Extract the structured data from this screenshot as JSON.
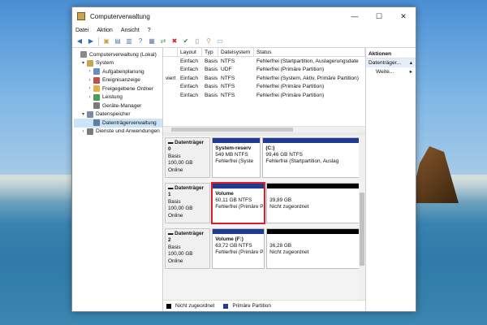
{
  "window": {
    "title": "Computerverwaltung"
  },
  "menu": [
    "Datei",
    "Aktion",
    "Ansicht",
    "?"
  ],
  "tree": [
    {
      "label": "Computerverwaltung (Lokal)",
      "level": 0,
      "exp": "",
      "color": "#8a8a8a"
    },
    {
      "label": "System",
      "level": 1,
      "exp": "▾",
      "color": "#c9a54b"
    },
    {
      "label": "Aufgabenplanung",
      "level": 2,
      "exp": "›",
      "color": "#6a8fbf"
    },
    {
      "label": "Ereignisanzeige",
      "level": 2,
      "exp": "›",
      "color": "#c0504d"
    },
    {
      "label": "Freigegebene Ordner",
      "level": 2,
      "exp": "›",
      "color": "#e3b341"
    },
    {
      "label": "Leistung",
      "level": 2,
      "exp": "›",
      "color": "#4b9e5a"
    },
    {
      "label": "Geräte-Manager",
      "level": 2,
      "exp": "",
      "color": "#7b7b7b"
    },
    {
      "label": "Datenspeicher",
      "level": 1,
      "exp": "▾",
      "color": "#7b8da3"
    },
    {
      "label": "Datenträgerverwaltung",
      "level": 2,
      "exp": "",
      "color": "#5b7fa6",
      "selected": true
    },
    {
      "label": "Dienste und Anwendungen",
      "level": 1,
      "exp": "›",
      "color": "#7b7b7b"
    }
  ],
  "volume_table": {
    "headers": [
      "",
      "Layout",
      "Typ",
      "Dateisystem",
      "Status"
    ],
    "rows": [
      [
        "",
        "Einfach",
        "Basis",
        "NTFS",
        "Fehlerfrei (Startpartition, Auslagerungsdate"
      ],
      [
        "",
        "Einfach",
        "Basis",
        "UDF",
        "Fehlerfrei (Primäre Partition)"
      ],
      [
        "viert",
        "Einfach",
        "Basis",
        "NTFS",
        "Fehlerfrei (System, Aktiv, Primäre Partition)"
      ],
      [
        "",
        "Einfach",
        "Basis",
        "NTFS",
        "Fehlerfrei (Primäre Partition)"
      ],
      [
        "",
        "Einfach",
        "Basis",
        "NTFS",
        "Fehlerfrei (Primäre Partition)"
      ]
    ]
  },
  "disks": [
    {
      "name": "Datenträger 0",
      "type": "Basis",
      "size": "100,00 GB",
      "state": "Online",
      "partitions": [
        {
          "line1": "System-reserv",
          "line2": "549 MB NTFS",
          "line3": "Fehlerfrei (Syste",
          "bar": "#1f3b8f",
          "highlight": false
        },
        {
          "line1": "(C:)",
          "line2": "99,46 GB NTFS",
          "line3": "Fehlerfrei (Startpartition, Auslag",
          "bar": "#1f3b8f",
          "highlight": false
        }
      ]
    },
    {
      "name": "Datenträger 1",
      "type": "Basis",
      "size": "100,00 GB",
      "state": "Online",
      "partitions": [
        {
          "line1": "Volume",
          "line2": "60,11 GB NTFS",
          "line3": "Fehlerfrei (Primäre Partit",
          "bar": "#1f3b8f",
          "highlight": true
        },
        {
          "line1": "",
          "line2": "39,89 GB",
          "line3": "Nicht zugeordnet",
          "bar": "#000000",
          "highlight": false
        }
      ]
    },
    {
      "name": "Datenträger 2",
      "type": "Basis",
      "size": "100,00 GB",
      "state": "Online",
      "partitions": [
        {
          "line1": "Volume  (F:)",
          "line2": "63,72 GB NTFS",
          "line3": "Fehlerfrei (Primäre Partit",
          "bar": "#1f3b8f",
          "highlight": false
        },
        {
          "line1": "",
          "line2": "36,28 GB",
          "line3": "Nicht zugeordnet",
          "bar": "#000000",
          "highlight": false
        }
      ]
    }
  ],
  "legend": [
    {
      "label": "Nicht zugeordnet",
      "color": "#000000"
    },
    {
      "label": "Primäre Partition",
      "color": "#1f3b8f"
    }
  ],
  "actions": {
    "title": "Aktionen",
    "section": "Datenträger...",
    "items": [
      "Weite..."
    ]
  }
}
